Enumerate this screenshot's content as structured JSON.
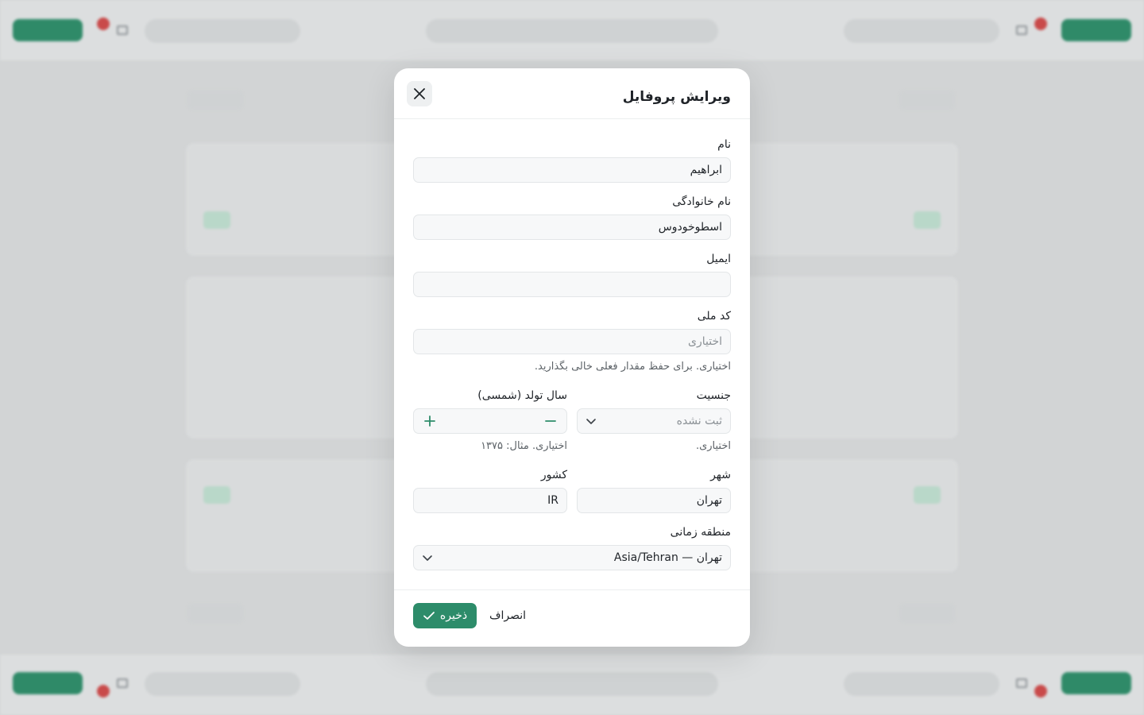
{
  "modal": {
    "title": "ویرایش پروفایل",
    "fields": {
      "first_name": {
        "label": "نام",
        "value": "ابراهیم"
      },
      "last_name": {
        "label": "نام خانوادگی",
        "value": "اسطوخودوس"
      },
      "email": {
        "label": "ایمیل",
        "value": ""
      },
      "national_code": {
        "label": "کد ملی",
        "placeholder": "اختیاری",
        "hint": "اختیاری. برای حفظ مقدار فعلی خالی بگذارید."
      },
      "gender": {
        "label": "جنسیت",
        "selected": "ثبت نشده",
        "hint": "اختیاری."
      },
      "birth_year": {
        "label": "سال تولد (شمسی)",
        "value": "",
        "hint": "اختیاری. مثال: ۱۳۷۵"
      },
      "city": {
        "label": "شهر",
        "value": "تهران"
      },
      "country": {
        "label": "کشور",
        "value": "IR"
      },
      "timezone": {
        "label": "منطقه زمانی",
        "selected": "تهران — Asia/Tehran"
      }
    },
    "footer": {
      "save_label": "ذخیره",
      "cancel_label": "انصراف"
    }
  },
  "colors": {
    "accent": "#2d8c6a",
    "badge": "#c94a4a"
  }
}
